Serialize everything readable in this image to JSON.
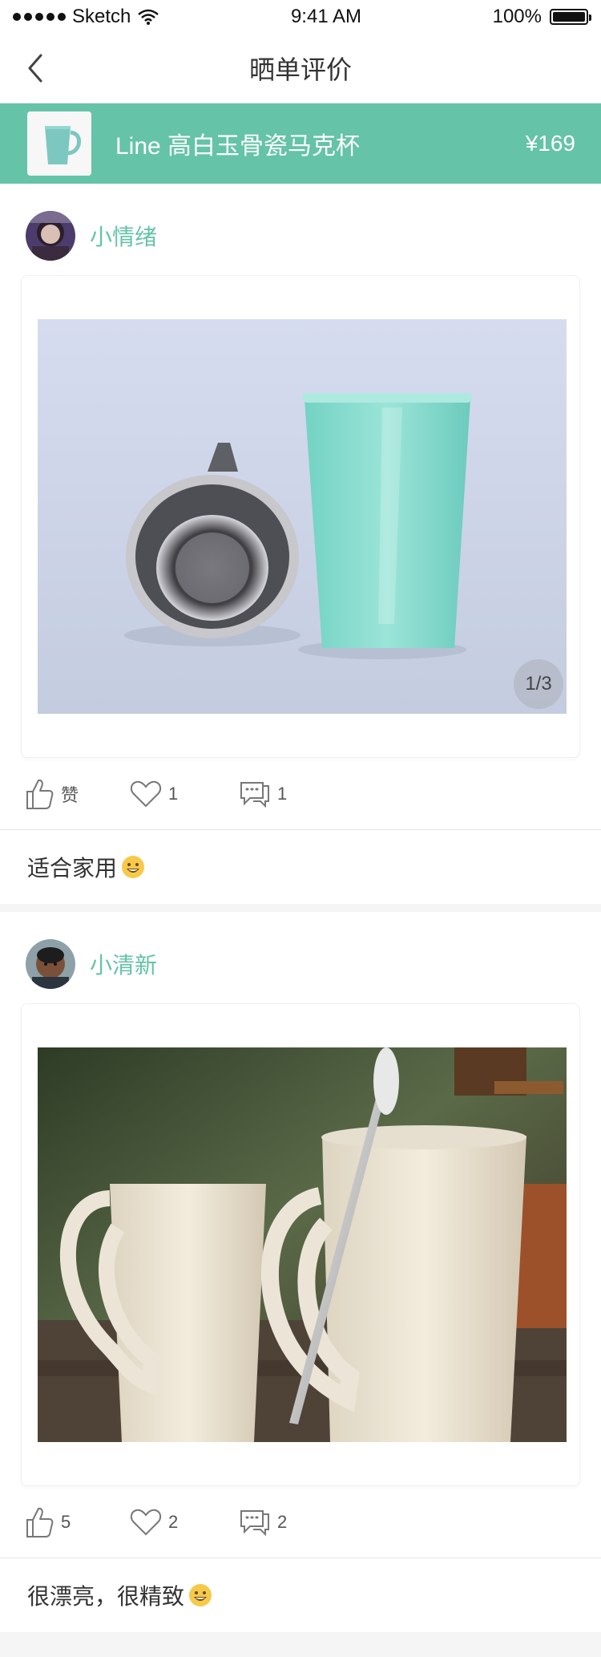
{
  "status": {
    "carrier": "Sketch",
    "time": "9:41 AM",
    "battery": "100%"
  },
  "nav": {
    "title": "晒单评价"
  },
  "product": {
    "name": "Line 高白玉骨瓷马克杯",
    "price": "¥169"
  },
  "reviews": [
    {
      "username": "小情绪",
      "photo_indicator": "1/3",
      "like_label": "赞",
      "fav_count": "1",
      "comment_count": "1",
      "text": "适合家用"
    },
    {
      "username": "小清新",
      "like_count": "5",
      "fav_count": "2",
      "comment_count": "2",
      "text": "很漂亮，很精致"
    }
  ],
  "icons": {
    "back": "chevron-left-icon",
    "like": "thumbs-up-icon",
    "fav": "heart-icon",
    "comment": "comment-icon",
    "emoji": "smile-emoji-icon"
  },
  "colors": {
    "accent": "#65c3a7",
    "background": "#f5f5f5"
  }
}
